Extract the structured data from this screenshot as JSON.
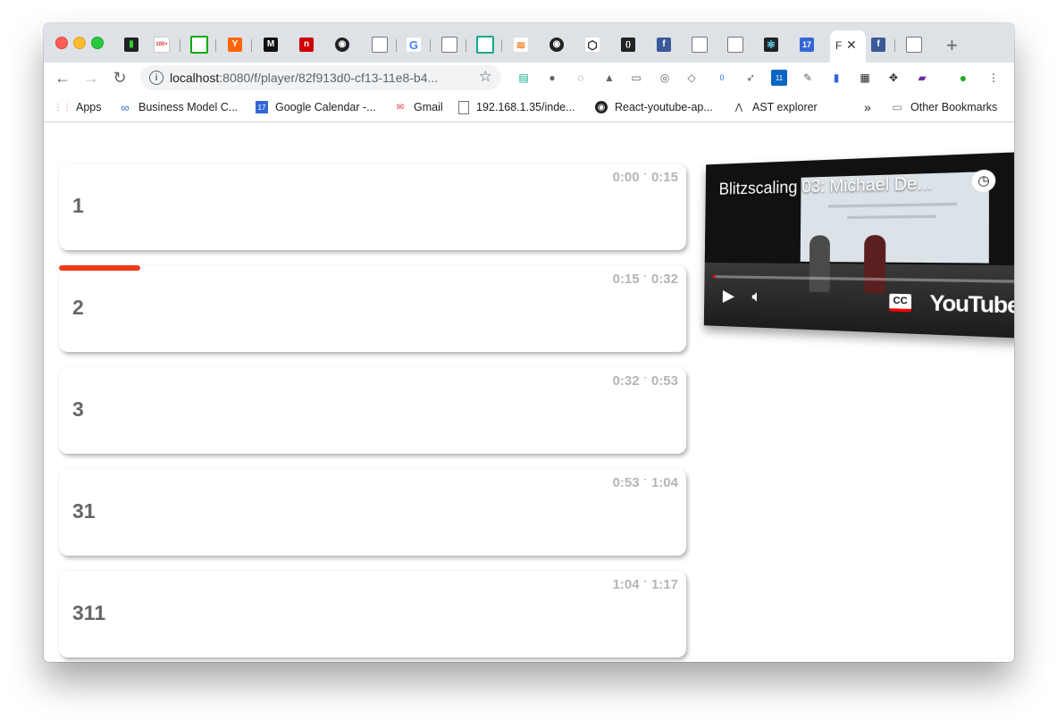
{
  "browser": {
    "active_tab_label": "F",
    "new_tab_label": "+",
    "url_host": "localhost",
    "url_path": ":8080/f/player/82f913d0-cf13-11e8-b4...",
    "bookmarks": [
      {
        "label": "Apps",
        "icon": "apps-grid-icon"
      },
      {
        "label": "Business Model C...",
        "icon": "infinity-icon"
      },
      {
        "label": "Google Calendar -...",
        "icon": "calendar-icon",
        "icon_text": "17"
      },
      {
        "label": "Gmail",
        "icon": "gmail-icon"
      },
      {
        "label": "192.168.1.35/inde...",
        "icon": "page-icon"
      },
      {
        "label": "React-youtube-ap...",
        "icon": "github-icon"
      },
      {
        "label": "AST explorer",
        "icon": "ast-icon"
      }
    ],
    "overflow_label": "»",
    "other_bookmarks_label": "Other Bookmarks",
    "calendar_tab_text": "17",
    "gmail_badge_text": "100+",
    "linkedin_badge_text": "11",
    "ext_badge_text": "0"
  },
  "segments": [
    {
      "label": "1",
      "start": "0:00",
      "end": "0:15"
    },
    {
      "label": "2",
      "start": "0:15",
      "end": "0:32"
    },
    {
      "label": "3",
      "start": "0:32",
      "end": "0:53"
    },
    {
      "label": "31",
      "start": "0:53",
      "end": "1:04"
    },
    {
      "label": "311",
      "start": "1:04",
      "end": "1:17"
    }
  ],
  "time_separator": "·",
  "active_segment_progress": 0.13,
  "video": {
    "title": "Blitzscaling 03: Michael De...",
    "brand": "YouTube",
    "cc_label": "CC",
    "played_fraction": 0.01
  },
  "colors": {
    "progress": "#ee3b1b",
    "time_text": "#b5b5b5",
    "label_text": "#666666"
  }
}
